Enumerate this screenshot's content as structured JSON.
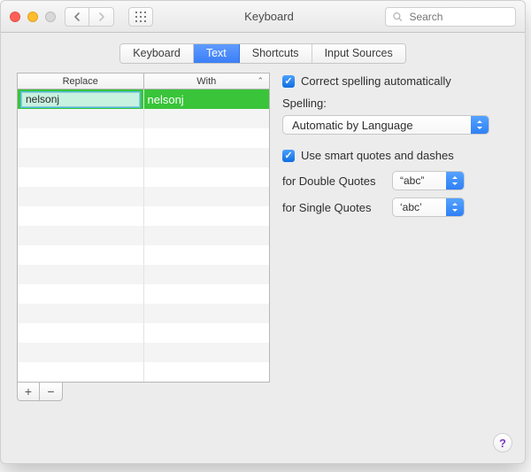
{
  "window": {
    "title": "Keyboard"
  },
  "toolbar": {
    "back_icon": "chevron-left",
    "forward_icon": "chevron-right",
    "apps_icon": "grid",
    "search_placeholder": "Search"
  },
  "tabs": [
    {
      "label": "Keyboard",
      "active": false
    },
    {
      "label": "Text",
      "active": true
    },
    {
      "label": "Shortcuts",
      "active": false
    },
    {
      "label": "Input Sources",
      "active": false
    }
  ],
  "table": {
    "headers": {
      "replace": "Replace",
      "with": "With"
    },
    "rows": [
      {
        "replace": "nelsonj",
        "with": "nelsonj",
        "editing": true
      }
    ],
    "total_visible_rows": 15,
    "buttons": {
      "add": "+",
      "remove": "−"
    }
  },
  "options": {
    "correct_spelling": {
      "checked": true,
      "label": "Correct spelling automatically"
    },
    "spelling": {
      "heading": "Spelling:",
      "value": "Automatic by Language"
    },
    "smart_quotes": {
      "checked": true,
      "label": "Use smart quotes and dashes"
    },
    "double_quotes": {
      "label": "for Double Quotes",
      "value": "“abc”"
    },
    "single_quotes": {
      "label": "for Single Quotes",
      "value": "‘abc’"
    }
  },
  "help": "?"
}
